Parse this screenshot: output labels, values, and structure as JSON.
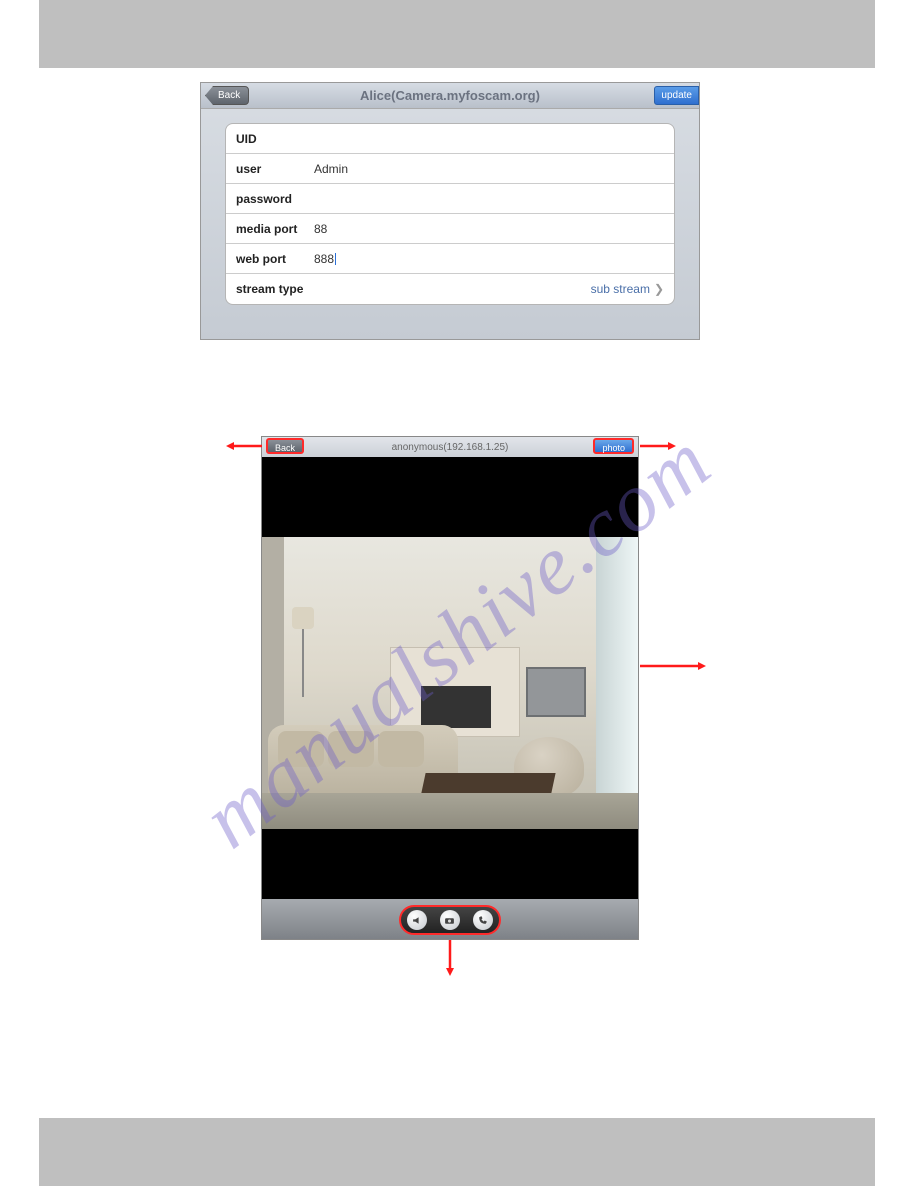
{
  "watermark": "manualshive.com",
  "settings": {
    "back_label": "Back",
    "update_label": "update",
    "title": "Alice(Camera.myfoscam.org)",
    "rows": {
      "uid_label": "UID",
      "uid_value": "",
      "user_label": "user",
      "user_value": "Admin",
      "password_label": "password",
      "password_value": "",
      "media_port_label": "media port",
      "media_port_value": "88",
      "web_port_label": "web port",
      "web_port_value": "888",
      "stream_type_label": "stream type",
      "stream_type_value": "sub stream"
    }
  },
  "camera": {
    "back_label": "Back",
    "photo_label": "photo",
    "title": "anonymous(192.168.1.25)"
  }
}
